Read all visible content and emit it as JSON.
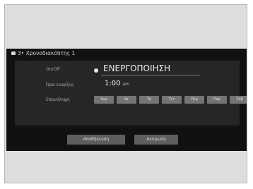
{
  "window": {
    "title": "3• Χρονοδιακόπτης 1"
  },
  "rows": {
    "onoff_label": "On/Off",
    "onoff_value": "ΕΝΕΡΓΟΠΟΙΗΣΗ",
    "time_label": "Ώρα έναρξης",
    "time_value": "1:00",
    "time_ampm": "am",
    "repeat_label": "Επανάληψη"
  },
  "days": [
    "Κυρ",
    "Δε",
    "Τρ",
    "Τετ",
    "Πέμ",
    "Παρ",
    "Σάβ"
  ],
  "buttons": {
    "save": "Αποθήκευση",
    "cancel": "Ακύρωση"
  },
  "colors": {
    "screen_bg": "#111111",
    "panel_bg": "#262626",
    "day_button": "#747474",
    "bottom_button": "#5e5e5e",
    "frame_bg": "#dddddd"
  }
}
